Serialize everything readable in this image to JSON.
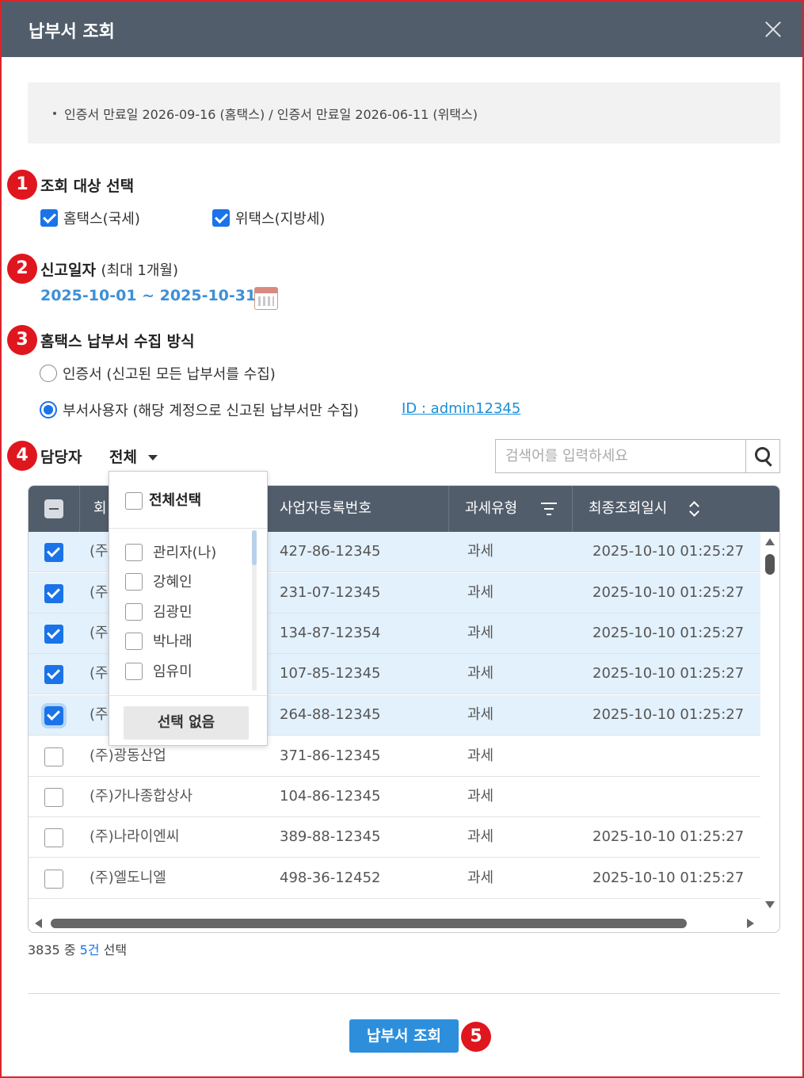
{
  "window": {
    "title": "납부서 조회"
  },
  "notice": {
    "text": "인증서 만료일 2026-09-16 (홈택스) / 인증서 만료일 2026-06-11 (위택스)"
  },
  "step_badges": [
    "1",
    "2",
    "3",
    "4",
    "5"
  ],
  "section1": {
    "title": "조회 대상 선택",
    "options": [
      {
        "label": "홈택스(국세)",
        "checked": true
      },
      {
        "label": "위택스(지방세)",
        "checked": true
      }
    ]
  },
  "section2": {
    "title": "신고일자",
    "subtitle": "(최대 1개월)",
    "date_range": "2025-10-01 ~ 2025-10-31"
  },
  "section3": {
    "title": "홈택스 납부서 수집 방식",
    "options": [
      {
        "label": "인증서 (신고된 모든 납부서를 수집)",
        "selected": false
      },
      {
        "label": "부서사용자 (해당 계정으로 신고된 납부서만 수집)",
        "selected": true
      }
    ],
    "id_link": "ID : admin12345"
  },
  "section4": {
    "title": "담당자",
    "selected": "전체",
    "dropdown": {
      "select_all": "전체선택",
      "items": [
        "관리자(나)",
        "강혜인",
        "김광민",
        "박나래",
        "임유미"
      ],
      "none_button": "선택 없음"
    }
  },
  "search": {
    "placeholder": "검색어를 입력하세요",
    "value": ""
  },
  "table": {
    "columns": [
      "회",
      "사업자등록번호",
      "과세유형",
      "최종조회일시"
    ],
    "rows": [
      {
        "name": "(주",
        "biz_no": "427-86-12345",
        "tax_type": "과세",
        "last_query": "2025-10-10 01:25:27",
        "checked": true
      },
      {
        "name": "(주",
        "biz_no": "231-07-12345",
        "tax_type": "과세",
        "last_query": "2025-10-10 01:25:27",
        "checked": true
      },
      {
        "name": "(주",
        "biz_no": "134-87-12354",
        "tax_type": "과세",
        "last_query": "2025-10-10 01:25:27",
        "checked": true
      },
      {
        "name": "(주",
        "biz_no": "107-85-12345",
        "tax_type": "과세",
        "last_query": "2025-10-10 01:25:27",
        "checked": true
      },
      {
        "name": "(주",
        "biz_no": "264-88-12345",
        "tax_type": "과세",
        "last_query": "2025-10-10 01:25:27",
        "checked": true
      },
      {
        "name": "(주)광동산업",
        "biz_no": "371-86-12345",
        "tax_type": "과세",
        "last_query": "",
        "checked": false
      },
      {
        "name": "(주)가나종합상사",
        "biz_no": "104-86-12345",
        "tax_type": "과세",
        "last_query": "",
        "checked": false
      },
      {
        "name": "(주)나라이엔씨",
        "biz_no": "389-88-12345",
        "tax_type": "과세",
        "last_query": "2025-10-10 01:25:27",
        "checked": false
      },
      {
        "name": "(주)엘도니엘",
        "biz_no": "498-36-12452",
        "tax_type": "과세",
        "last_query": "2025-10-10 01:25:27",
        "checked": false
      }
    ]
  },
  "summary": {
    "total": "3835",
    "middle": "중",
    "selected": "5건",
    "suffix": "선택"
  },
  "submit_label": "납부서 조회",
  "colors": {
    "header": "#525d6b",
    "accent": "#1a73e8",
    "badge": "#e0161e",
    "selected_row": "#e3f1fc",
    "button": "#2d8fdc"
  }
}
